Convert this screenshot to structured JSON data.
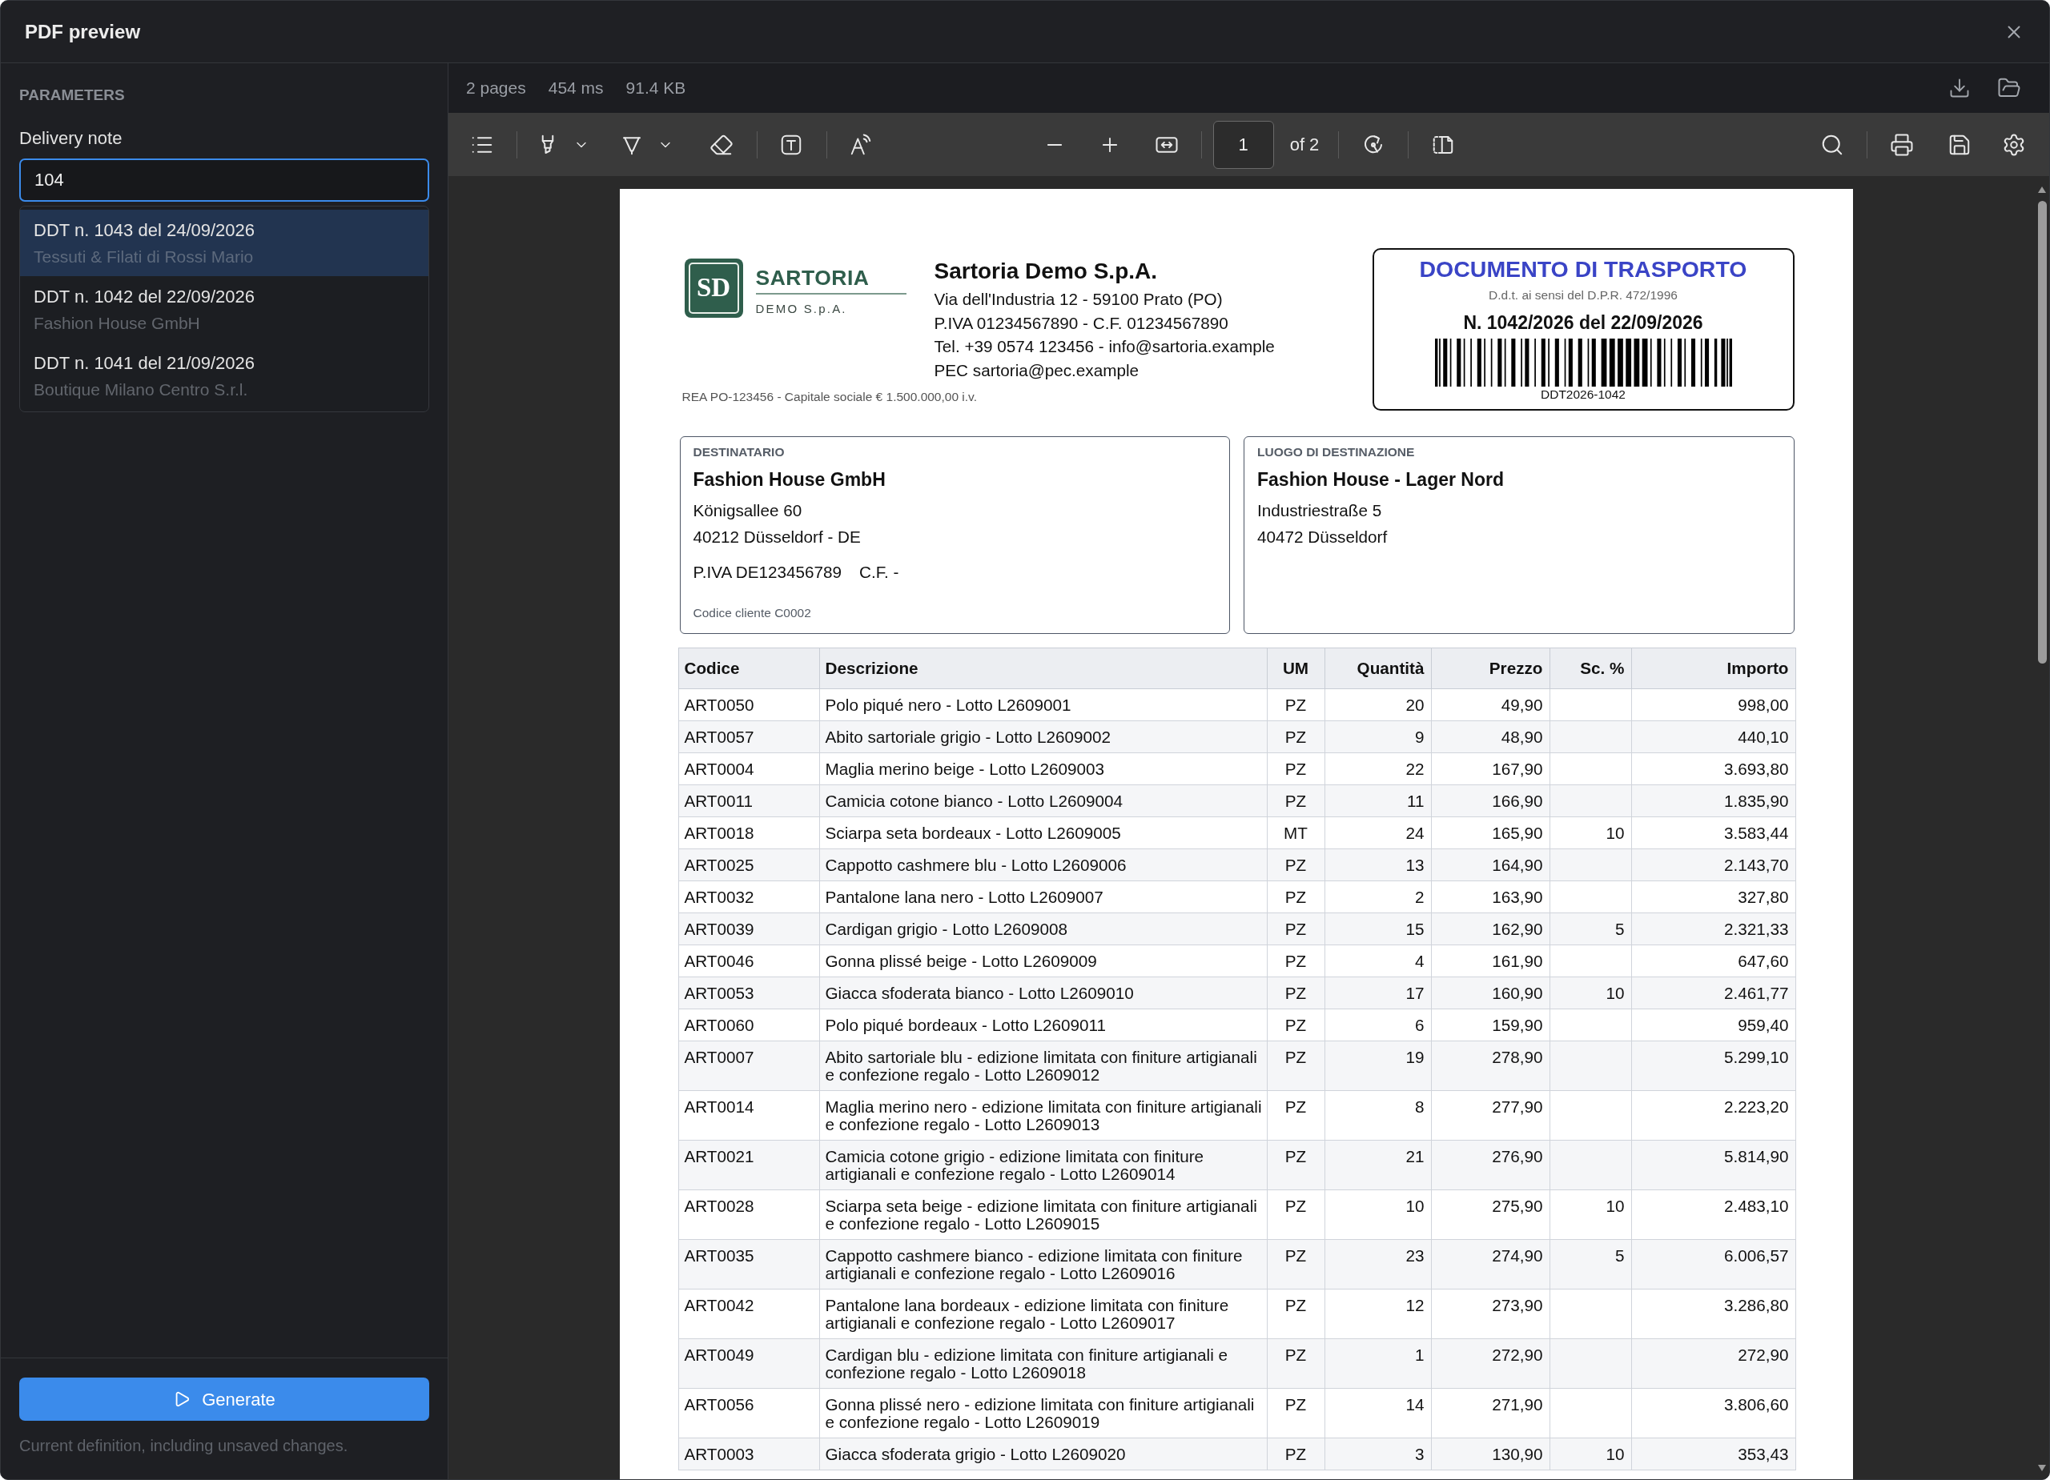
{
  "window": {
    "title": "PDF preview"
  },
  "sidebar": {
    "heading": "PARAMETERS",
    "field": {
      "label": "Delivery note",
      "value": "104",
      "focused": true
    },
    "suggestions": [
      {
        "title": "DDT n. 1043 del 24/09/2026",
        "subtitle": "Tessuti & Filati di Rossi Mario",
        "selected": true
      },
      {
        "title": "DDT n. 1042 del 22/09/2026",
        "subtitle": "Fashion House GmbH",
        "selected": false
      },
      {
        "title": "DDT n. 1041 del 21/09/2026",
        "subtitle": "Boutique Milano Centro S.r.l.",
        "selected": false
      }
    ],
    "generate_button": "Generate",
    "footnote": "Current definition, including unsaved changes."
  },
  "viewer": {
    "stats": [
      "2 pages",
      "454 ms",
      "91.4 KB"
    ],
    "toolbar": {
      "page_value": "1",
      "page_total": "of 2"
    },
    "document": {
      "logo": {
        "monogram": "SD",
        "name": "SARTORIA",
        "tagline": "DEMO S.p.A."
      },
      "company": {
        "name": "Sartoria Demo S.p.A.",
        "lines": [
          "Via dell'Industria 12 - 59100 Prato (PO)",
          "P.IVA 01234567890 - C.F. 01234567890",
          "Tel. +39 0574 123456 - info@sartoria.example",
          "PEC sartoria@pec.example"
        ]
      },
      "registry_note": "REA PO-123456 - Capitale sociale € 1.500.000,00 i.v.",
      "doc_box": {
        "title": "DOCUMENTO DI TRASPORTO",
        "subtitle": "D.d.t. ai sensi del D.P.R. 472/1996",
        "number": "N. 1042/2026 del 22/09/2026",
        "barcode_text": "DDT2026-1042"
      },
      "recipient": {
        "label": "DESTINATARIO",
        "name": "Fashion House GmbH",
        "lines": [
          "Königsallee 60",
          "40212 Düsseldorf - DE"
        ],
        "tax_ids": [
          "P.IVA DE123456789",
          "C.F. -"
        ],
        "customer_code": "Codice cliente C0002"
      },
      "destination": {
        "label": "LUOGO DI DESTINAZIONE",
        "name": "Fashion House - Lager Nord",
        "lines": [
          "Industriestraße 5",
          "40472 Düsseldorf"
        ]
      },
      "table": {
        "columns": [
          {
            "label": "Codice",
            "kind": "text"
          },
          {
            "label": "Descrizione",
            "kind": "text"
          },
          {
            "label": "UM",
            "kind": "unit"
          },
          {
            "label": "Quantità",
            "kind": "number"
          },
          {
            "label": "Prezzo",
            "kind": "number"
          },
          {
            "label": "Sc. %",
            "kind": "number"
          },
          {
            "label": "Importo",
            "kind": "number"
          }
        ],
        "rows": [
          {
            "code": "ART0050",
            "description": "Polo piqué nero - Lotto L2609001",
            "unit": "PZ",
            "quantity": "20",
            "price": "49,90",
            "amount": "998,00"
          },
          {
            "code": "ART0057",
            "description": "Abito sartoriale grigio - Lotto L2609002",
            "unit": "PZ",
            "quantity": "9",
            "price": "48,90",
            "amount": "440,10"
          },
          {
            "code": "ART0004",
            "description": "Maglia merino beige - Lotto L2609003",
            "unit": "PZ",
            "quantity": "22",
            "price": "167,90",
            "amount": "3.693,80"
          },
          {
            "code": "ART0011",
            "description": "Camicia cotone bianco - Lotto L2609004",
            "unit": "PZ",
            "quantity": "11",
            "price": "166,90",
            "amount": "1.835,90"
          },
          {
            "code": "ART0018",
            "description": "Sciarpa seta bordeaux - Lotto L2609005",
            "unit": "MT",
            "quantity": "24",
            "price": "165,90",
            "discount": "10",
            "amount": "3.583,44"
          },
          {
            "code": "ART0025",
            "description": "Cappotto cashmere blu - Lotto L2609006",
            "unit": "PZ",
            "quantity": "13",
            "price": "164,90",
            "amount": "2.143,70"
          },
          {
            "code": "ART0032",
            "description": "Pantalone lana nero - Lotto L2609007",
            "unit": "PZ",
            "quantity": "2",
            "price": "163,90",
            "amount": "327,80"
          },
          {
            "code": "ART0039",
            "description": "Cardigan grigio - Lotto L2609008",
            "unit": "PZ",
            "quantity": "15",
            "price": "162,90",
            "discount": "5",
            "amount": "2.321,33"
          },
          {
            "code": "ART0046",
            "description": "Gonna plissé beige - Lotto L2609009",
            "unit": "PZ",
            "quantity": "4",
            "price": "161,90",
            "amount": "647,60"
          },
          {
            "code": "ART0053",
            "description": "Giacca sfoderata bianco - Lotto L2609010",
            "unit": "PZ",
            "quantity": "17",
            "price": "160,90",
            "discount": "10",
            "amount": "2.461,77"
          },
          {
            "code": "ART0060",
            "description": "Polo piqué bordeaux - Lotto L2609011",
            "unit": "PZ",
            "quantity": "6",
            "price": "159,90",
            "amount": "959,40"
          },
          {
            "code": "ART0007",
            "description": "Abito sartoriale blu - edizione limitata con finiture artigianali e confezione regalo - Lotto L2609012",
            "unit": "PZ",
            "quantity": "19",
            "price": "278,90",
            "amount": "5.299,10"
          },
          {
            "code": "ART0014",
            "description": "Maglia merino nero - edizione limitata con finiture artigianali e confezione regalo - Lotto L2609013",
            "unit": "PZ",
            "quantity": "8",
            "price": "277,90",
            "amount": "2.223,20"
          },
          {
            "code": "ART0021",
            "description": "Camicia cotone grigio - edizione limitata con finiture artigianali e confezione regalo - Lotto L2609014",
            "unit": "PZ",
            "quantity": "21",
            "price": "276,90",
            "amount": "5.814,90"
          },
          {
            "code": "ART0028",
            "description": "Sciarpa seta beige - edizione limitata con finiture artigianali e confezione regalo - Lotto L2609015",
            "unit": "PZ",
            "quantity": "10",
            "price": "275,90",
            "discount": "10",
            "amount": "2.483,10"
          },
          {
            "code": "ART0035",
            "description": "Cappotto cashmere bianco - edizione limitata con finiture artigianali e confezione regalo - Lotto L2609016",
            "unit": "PZ",
            "quantity": "23",
            "price": "274,90",
            "discount": "5",
            "amount": "6.006,57"
          },
          {
            "code": "ART0042",
            "description": "Pantalone lana bordeaux - edizione limitata con finiture artigianali e confezione regalo - Lotto L2609017",
            "unit": "PZ",
            "quantity": "12",
            "price": "273,90",
            "amount": "3.286,80"
          },
          {
            "code": "ART0049",
            "description": "Cardigan blu - edizione limitata con finiture artigianali e confezione regalo - Lotto L2609018",
            "unit": "PZ",
            "quantity": "1",
            "price": "272,90",
            "amount": "272,90"
          },
          {
            "code": "ART0056",
            "description": "Gonna plissé nero - edizione limitata con finiture artigianali e confezione regalo - Lotto L2609019",
            "unit": "PZ",
            "quantity": "14",
            "price": "271,90",
            "amount": "3.806,60"
          },
          {
            "code": "ART0003",
            "description": "Giacca sfoderata grigio - Lotto L2609020",
            "unit": "PZ",
            "quantity": "3",
            "price": "130,90",
            "discount": "10",
            "amount": "353,43"
          }
        ]
      }
    }
  }
}
